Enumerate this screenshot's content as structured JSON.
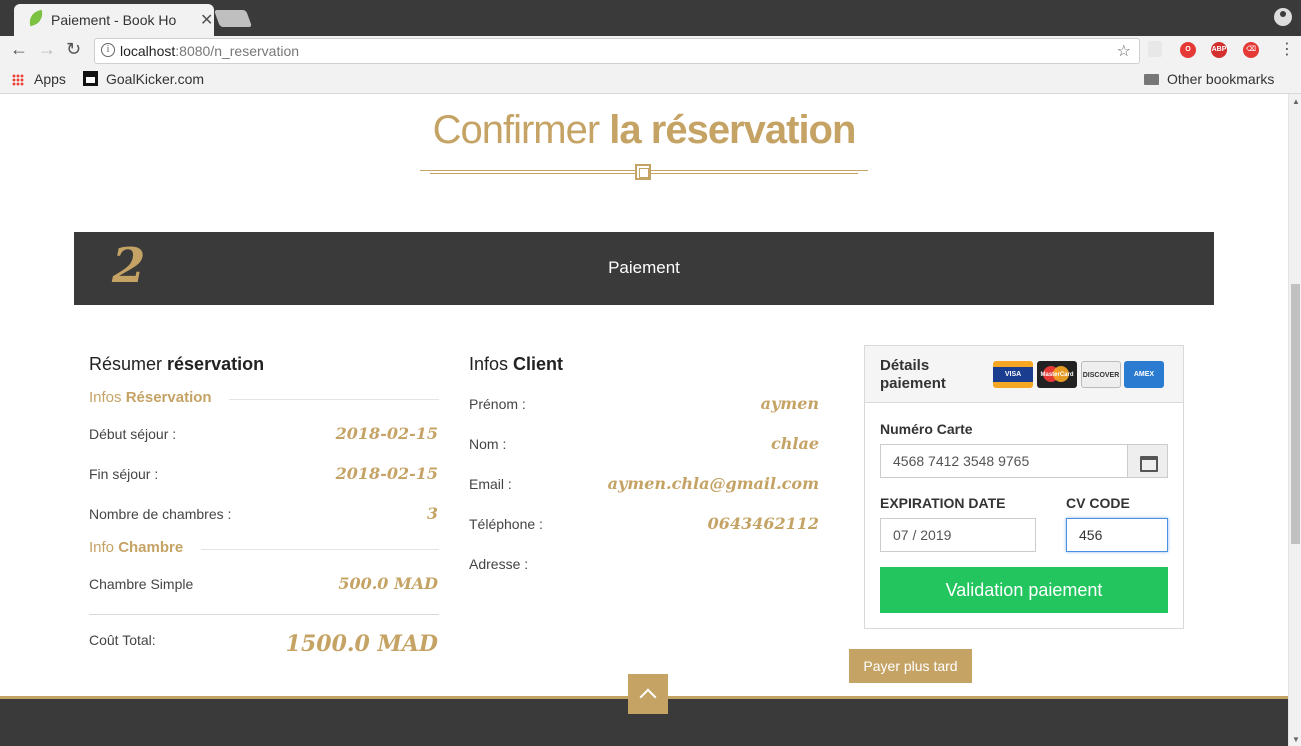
{
  "browser": {
    "tab_title": "Paiement - Book Ho",
    "tab_close": "✕",
    "url_host": "localhost",
    "url_rest": ":8080/n_reservation",
    "bookmarks": {
      "apps": "Apps",
      "goalkicker": "GoalKicker.com",
      "other": "Other bookmarks"
    },
    "ext_abp": "ABP"
  },
  "page": {
    "heading_light": "Confirmer ",
    "heading_bold": "la réservation",
    "step_number": "2",
    "step_title": "Paiement"
  },
  "summary": {
    "title_light": "Résumer ",
    "title_bold": "réservation",
    "reservation_section_light": "Infos ",
    "reservation_section_bold": "Réservation",
    "rows": [
      {
        "label": "Début séjour :",
        "value": "2018-02-15"
      },
      {
        "label": "Fin séjour :",
        "value": "2018-02-15"
      },
      {
        "label": "Nombre de chambres :",
        "value": "3"
      }
    ],
    "room_section_light": "Info ",
    "room_section_bold": "Chambre",
    "room": {
      "label": "Chambre Simple",
      "value": "500.0 MAD"
    },
    "total": {
      "label": "Coût Total:",
      "value": "1500.0 MAD"
    }
  },
  "client": {
    "title_light": "Infos ",
    "title_bold": "Client",
    "rows": [
      {
        "label": "Prénom :",
        "value": "aymen"
      },
      {
        "label": "Nom :",
        "value": "chlae"
      },
      {
        "label": "Email :",
        "value": "aymen.chla@gmail.com"
      },
      {
        "label": "Téléphone :",
        "value": "0643462112"
      },
      {
        "label": "Adresse :",
        "value": ""
      }
    ]
  },
  "payment": {
    "title": "Détails paiement",
    "card_logos": [
      "VISA",
      "MasterCard",
      "DISCOVER",
      "AMEX"
    ],
    "card_number_label": "Numéro Carte",
    "card_number_value": "4568 7412 3548 9765",
    "expiration_label": "EXPIRATION DATE",
    "expiration_value": "07 / 2019",
    "cv_label": "CV CODE",
    "cv_value": "456",
    "submit_label": "Validation paiement",
    "later_label": "Payer plus tard"
  },
  "colors": {
    "gold": "#c5a365",
    "dark": "#3a3a3a",
    "green": "#22c55e"
  }
}
